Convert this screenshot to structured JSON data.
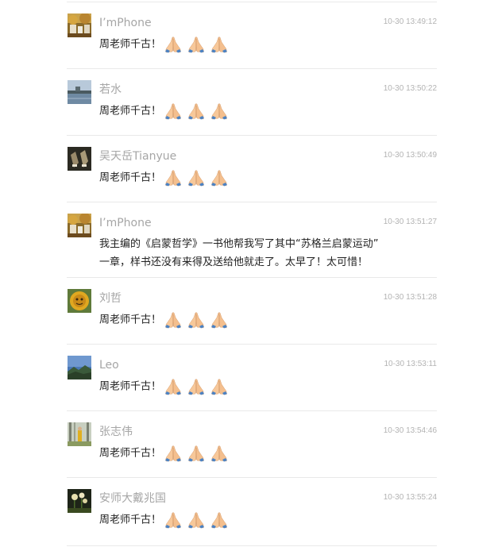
{
  "comments": [
    {
      "nickname": "I’mPhone",
      "time": "10-30 13:49:12",
      "text": "周老师千古！",
      "emoji": "pray-icon",
      "emoji_count": 3,
      "avatar": "autumn"
    },
    {
      "nickname": "若水",
      "time": "10-30 13:50:22",
      "text": "周老师千古！",
      "emoji": "pray-icon",
      "emoji_count": 3,
      "avatar": "lake"
    },
    {
      "nickname": "吴天岳Tianyue",
      "time": "10-30 13:50:49",
      "text": "周老师千古！",
      "emoji": "pray-icon",
      "emoji_count": 3,
      "avatar": "shoes"
    },
    {
      "nickname": "I’mPhone",
      "time": "10-30 13:51:27",
      "text_lines": [
        "我主编的《启蒙哲学》一书他帮我写了其中“苏格兰启蒙运动”",
        "一章，样书还没有来得及送给他就走了。太早了！太可惜！"
      ],
      "avatar": "autumn"
    },
    {
      "nickname": "刘哲",
      "time": "10-30 13:51:28",
      "text": "周老师千古！",
      "emoji": "pray-icon",
      "emoji_count": 3,
      "avatar": "sunflower"
    },
    {
      "nickname": "Leo",
      "time": "10-30 13:53:11",
      "text": "周老师千古！",
      "emoji": "pray-icon",
      "emoji_count": 3,
      "avatar": "sky"
    },
    {
      "nickname": "张志伟",
      "time": "10-30 13:54:46",
      "text": "周老师千古！",
      "emoji": "pray-icon",
      "emoji_count": 3,
      "avatar": "forest"
    },
    {
      "nickname": "安师大戴兆国",
      "time": "10-30 13:55:24",
      "text": "周老师千古！",
      "emoji": "pray-icon",
      "emoji_count": 3,
      "avatar": "flowers"
    }
  ]
}
